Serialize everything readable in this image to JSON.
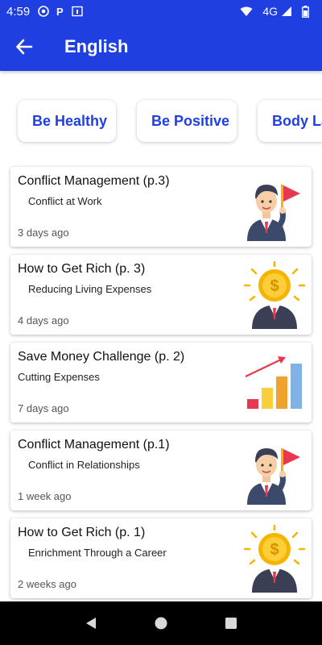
{
  "status": {
    "time": "4:59",
    "network": "4G"
  },
  "appbar": {
    "title": "English"
  },
  "chips": [
    {
      "label": "Be Healthy"
    },
    {
      "label": "Be Positive"
    },
    {
      "label": "Body La"
    }
  ],
  "cards": [
    {
      "title": "Conflict Management (p.3)",
      "subtitle": "Conflict at Work",
      "time": "3 days ago",
      "image": "businessman-flag-icon"
    },
    {
      "title": "How to Get Rich (p. 3)",
      "subtitle": "Reducing Living Expenses",
      "time": "4 days ago",
      "image": "coin-head-businessman-icon"
    },
    {
      "title": "Save Money Challenge (p. 2)",
      "subtitle": "Cutting Expenses",
      "time": "7 days ago",
      "image": "growth-bar-chart-icon"
    },
    {
      "title": "Conflict Management (p.1)",
      "subtitle": "Conflict in Relationships",
      "time": "1 week ago",
      "image": "businessman-flag-icon"
    },
    {
      "title": "How to Get Rich (p. 1)",
      "subtitle": "Enrichment Through a Career",
      "time": "2 weeks ago",
      "image": "coin-head-businessman-icon"
    }
  ],
  "colors": {
    "primary": "#1f3fe0",
    "navbar": "#000000"
  }
}
